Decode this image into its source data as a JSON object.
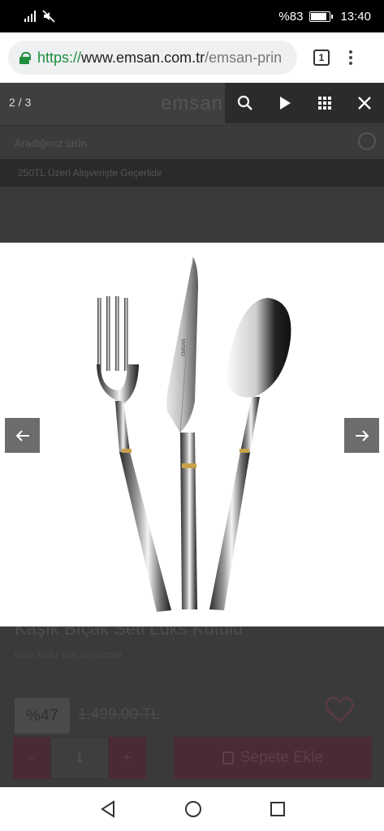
{
  "status_bar": {
    "battery_percent": "%83",
    "battery_level": 0.83,
    "time": "13:40"
  },
  "browser": {
    "url_scheme": "https://",
    "url_host": "www.emsan.com.tr",
    "url_path": "/emsan-prin",
    "tab_count": "1"
  },
  "page": {
    "logo": "emsan",
    "search_placeholder": "Aradığınız ürün",
    "promo": "250TL Üzeri Alışverişte Geçerlidir",
    "product_title": "Kaşık Bıçak Seti Lüks Kutulu",
    "product_code": "Ürün Kodu: 600.02.010208",
    "discount": "%47",
    "old_price": "1.499,00 TL",
    "qty_minus": "-",
    "qty_value": "1",
    "qty_plus": "+",
    "add_to_cart": "Sepete Ekle"
  },
  "gallery": {
    "counter": "2 / 3",
    "image_alt": "Fork, knife and spoon",
    "knife_engraving": "EMSAN"
  },
  "colors": {
    "accent_green": "#1e8e3e",
    "cart_color": "#4a2a35"
  }
}
